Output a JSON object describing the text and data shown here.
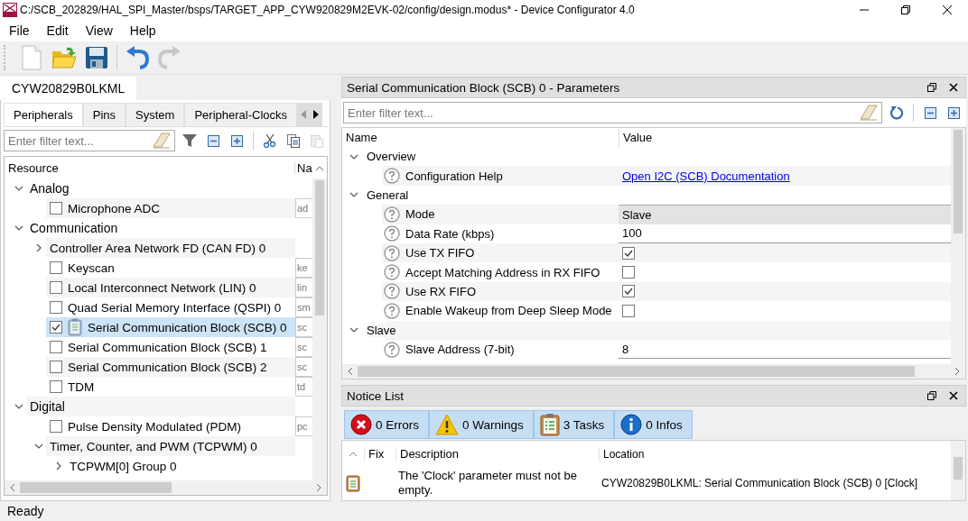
{
  "window": {
    "title": "C:/SCB_202829/HAL_SPI_Master/bsps/TARGET_APP_CYW920829M2EVK-02/config/design.modus* - Device Configurator 4.0"
  },
  "menu": [
    "File",
    "Edit",
    "View",
    "Help"
  ],
  "toolbar": [
    {
      "kind": "new",
      "disabled": false
    },
    {
      "kind": "open",
      "disabled": false
    },
    {
      "kind": "save",
      "disabled": false
    },
    {
      "kind": "undo",
      "disabled": false
    },
    {
      "kind": "redo",
      "disabled": true
    }
  ],
  "device_tab": "CYW20829B0LKML",
  "left_panel": {
    "tabs": [
      {
        "label": "Peripherals",
        "selected": true
      },
      {
        "label": "Pins",
        "selected": false
      },
      {
        "label": "System",
        "selected": false
      },
      {
        "label": "Peripheral-Clocks",
        "selected": false
      }
    ],
    "filter": {
      "placeholder": "Enter filter text..."
    },
    "tools": [
      {
        "kind": "funnel",
        "disabled": false
      },
      {
        "kind": "collapse",
        "disabled": false
      },
      {
        "kind": "expand",
        "disabled": false
      },
      {
        "kind": "cut",
        "disabled": false
      },
      {
        "kind": "copy",
        "disabled": false
      },
      {
        "kind": "paste",
        "disabled": true
      }
    ],
    "tree": {
      "columns": [
        "Resource",
        "Na"
      ],
      "items": [
        {
          "kind": "category",
          "label": "Analog",
          "expanded": true,
          "selected": false,
          "children": [
            {
              "kind": "resource",
              "label": "Microphone ADC",
              "checked": false,
              "selected": false,
              "flagged": false,
              "name": "ad"
            }
          ]
        },
        {
          "kind": "category",
          "label": "Communication",
          "expanded": true,
          "selected": false,
          "children": [
            {
              "kind": "group",
              "label": "Controller Area Network FD (CAN FD) 0",
              "expanded": false,
              "selected": false
            },
            {
              "kind": "resource",
              "label": "Keyscan",
              "checked": false,
              "selected": false,
              "flagged": false,
              "name": "ke"
            },
            {
              "kind": "resource",
              "label": "Local Interconnect Network (LIN) 0",
              "checked": false,
              "selected": false,
              "flagged": false,
              "name": "lin"
            },
            {
              "kind": "resource",
              "label": "Quad Serial Memory Interface (QSPI) 0",
              "checked": false,
              "selected": false,
              "flagged": false,
              "name": "sm"
            },
            {
              "kind": "resource",
              "label": "Serial Communication Block (SCB) 0",
              "checked": true,
              "selected": true,
              "flagged": true,
              "name": "sc"
            },
            {
              "kind": "resource",
              "label": "Serial Communication Block (SCB) 1",
              "checked": false,
              "selected": false,
              "flagged": false,
              "name": "sc"
            },
            {
              "kind": "resource",
              "label": "Serial Communication Block (SCB) 2",
              "checked": false,
              "selected": false,
              "flagged": false,
              "name": "sc"
            },
            {
              "kind": "resource",
              "label": "TDM",
              "checked": false,
              "selected": false,
              "flagged": false,
              "name": "td"
            }
          ]
        },
        {
          "kind": "category",
          "label": "Digital",
          "expanded": true,
          "selected": false,
          "children": [
            {
              "kind": "resource",
              "label": "Pulse Density Modulated (PDM)",
              "checked": false,
              "selected": false,
              "flagged": false,
              "name": "pc"
            },
            {
              "kind": "group",
              "label": "Timer, Counter, and PWM (TCPWM) 0",
              "expanded": true,
              "selected": false,
              "children": [
                {
                  "kind": "group",
                  "label": "TCPWM[0] Group 0",
                  "expanded": false,
                  "selected": false
                }
              ]
            }
          ]
        }
      ]
    }
  },
  "parameters": {
    "title": "Serial Communication Block (SCB) 0 - Parameters",
    "filter": {
      "placeholder": "Enter filter text..."
    },
    "columns": [
      "Name",
      "Value"
    ],
    "groups": [
      {
        "label": "Overview",
        "expanded": true,
        "params": [
          {
            "label": "Configuration Help",
            "kind": "link",
            "value": "Open I2C (SCB) Documentation"
          }
        ]
      },
      {
        "label": "General",
        "expanded": true,
        "params": [
          {
            "label": "Mode",
            "kind": "combo",
            "value": "Slave"
          },
          {
            "label": "Data Rate (kbps)",
            "kind": "text",
            "value": "100"
          },
          {
            "label": "Use TX FIFO",
            "kind": "checkbox",
            "checked": true
          },
          {
            "label": "Accept Matching Address in RX FIFO",
            "kind": "checkbox",
            "checked": false
          },
          {
            "label": "Use RX FIFO",
            "kind": "checkbox",
            "checked": true
          },
          {
            "label": "Enable Wakeup from Deep Sleep Mode",
            "kind": "checkbox",
            "checked": false
          }
        ]
      },
      {
        "label": "Slave",
        "expanded": true,
        "params": [
          {
            "label": "Slave Address (7-bit)",
            "kind": "text",
            "value": "8"
          }
        ]
      }
    ]
  },
  "notice_list": {
    "title": "Notice List",
    "filters": [
      {
        "kind": "error",
        "label": "0 Errors",
        "selected": true
      },
      {
        "kind": "warning",
        "label": "0 Warnings",
        "selected": true
      },
      {
        "kind": "task",
        "label": "3 Tasks",
        "selected": true
      },
      {
        "kind": "info",
        "label": "0 Infos",
        "selected": true
      }
    ],
    "columns": [
      "Fix",
      "Description",
      "Location"
    ],
    "rows": [
      {
        "kind": "task",
        "description": "The 'Clock' parameter must not be empty.",
        "location": "CYW20829B0LKML: Serial Communication Block (SCB) 0 [Clock]"
      }
    ]
  },
  "status_bar": "Ready"
}
